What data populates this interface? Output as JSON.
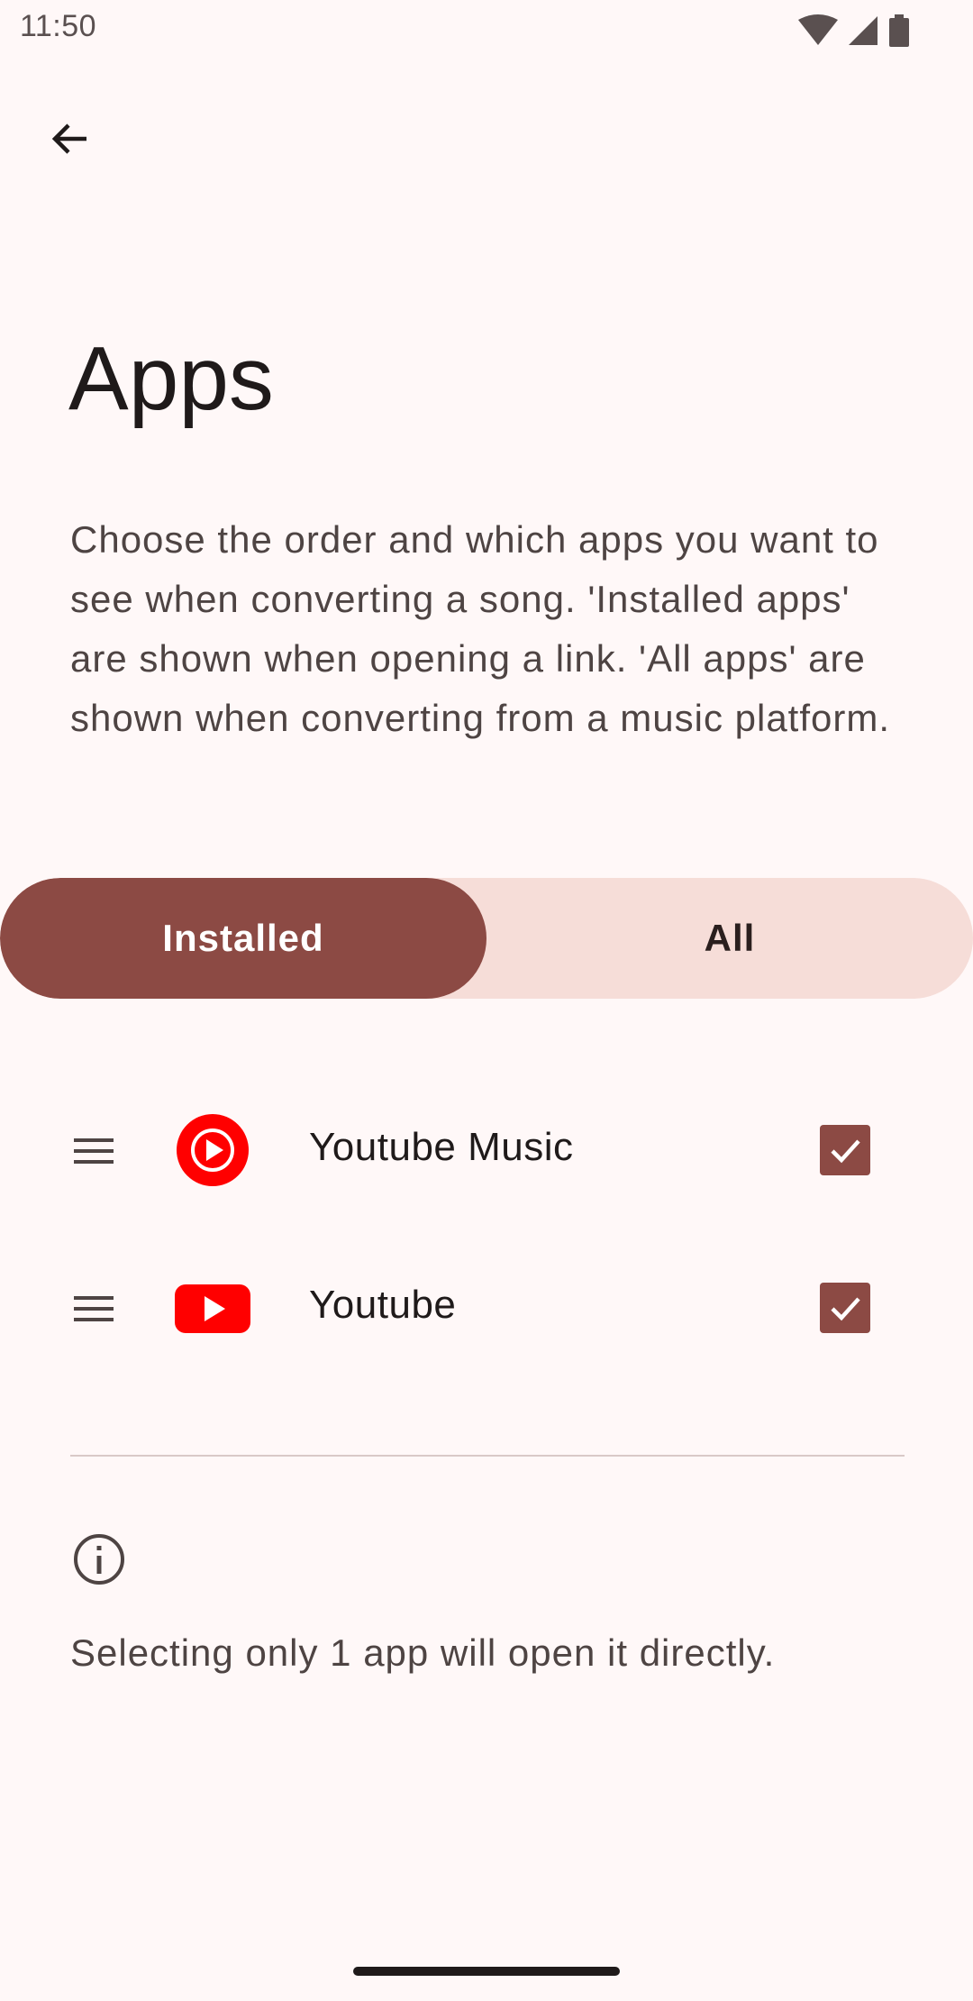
{
  "status_bar": {
    "time": "11:50",
    "icons": [
      "wifi-icon",
      "signal-icon",
      "battery-icon"
    ]
  },
  "header": {
    "back_icon": "arrow-back-icon",
    "title": "Apps"
  },
  "description": "Choose the order and which apps you want to see when converting a song. 'Installed apps' are shown when opening a link. 'All apps' are shown when converting from a music platform.",
  "segmented": {
    "options": [
      {
        "label": "Installed",
        "selected": true
      },
      {
        "label": "All",
        "selected": false
      }
    ]
  },
  "apps": [
    {
      "name": "Youtube Music",
      "icon": "youtube-music-icon",
      "checked": true
    },
    {
      "name": "Youtube",
      "icon": "youtube-icon",
      "checked": true
    }
  ],
  "info": {
    "icon": "info-icon",
    "text": "Selecting only 1 app will open it directly."
  },
  "colors": {
    "primary": "#8C4A44",
    "segment_background": "#F6DDD8",
    "background": "#FFF8F8",
    "youtube_red": "#FF0000"
  }
}
